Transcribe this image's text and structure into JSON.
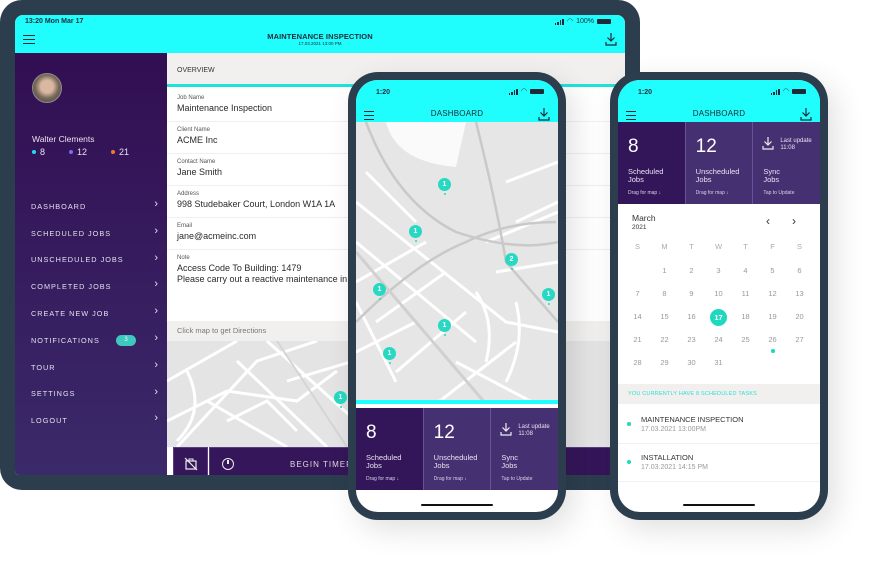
{
  "tablet": {
    "status": {
      "time": "13:20  Mon Mar 17",
      "battery": "100%"
    },
    "header": {
      "title": "MAINTENANCE INSPECTION",
      "subtitle": "17.03.2021   13:00 PM"
    },
    "user": {
      "name": "Walter Clements",
      "stats": [
        {
          "value": "8",
          "color": "#1fe0f0"
        },
        {
          "value": "12",
          "color": "#7b6cf0"
        },
        {
          "value": "21",
          "color": "#f07a2a"
        }
      ]
    },
    "nav": [
      {
        "label": "DASHBOARD"
      },
      {
        "label": "SCHEDULED JOBS"
      },
      {
        "label": "UNSCHEDULED JOBS"
      },
      {
        "label": "COMPLETED JOBS"
      },
      {
        "label": "CREATE NEW JOB"
      },
      {
        "label": "NOTIFICATIONS",
        "badge": "3"
      },
      {
        "label": "TOUR"
      },
      {
        "label": "SETTINGS"
      },
      {
        "label": "LOGOUT"
      }
    ],
    "overview_label": "OVERVIEW",
    "fields": [
      {
        "label": "Job Name",
        "value": "Maintenance Inspection"
      },
      {
        "label": "Client Name",
        "value": "ACME Inc"
      },
      {
        "label": "Contact Name",
        "value": "Jane Smith"
      },
      {
        "label": "Address",
        "value": "998 Studebaker Court, London W1A 1A"
      },
      {
        "label": "Email",
        "value": "jane@acmeinc.com"
      },
      {
        "label": "Note",
        "value": "Access Code To Building: 1479",
        "value2": "Please carry out a reactive maintenance in"
      }
    ],
    "directions_label": "Click map to get Directions",
    "map_pin": "1",
    "begin_timer_label": "BEGIN TIMER"
  },
  "phone1": {
    "time": "1:20",
    "title": "DASHBOARD",
    "pins": [
      "1",
      "1",
      "2",
      "1",
      "1",
      "1",
      "1"
    ],
    "tiles": [
      {
        "num": "8",
        "label1": "Scheduled",
        "label2": "Jobs",
        "sub": "Drag for map ↓"
      },
      {
        "num": "12",
        "label1": "Unscheduled",
        "label2": "Jobs",
        "sub": "Drag for map ↓"
      },
      {
        "update1": "Last update",
        "update2": "11:08",
        "label1": "Sync",
        "label2": "Jobs",
        "sub": "Tap to Update"
      }
    ]
  },
  "phone2": {
    "time": "1:20",
    "title": "DASHBOARD",
    "tiles": [
      {
        "num": "8",
        "label1": "Scheduled",
        "label2": "Jobs",
        "sub": "Drag for map ↓"
      },
      {
        "num": "12",
        "label1": "Unscheduled",
        "label2": "Jobs",
        "sub": "Drag for map ↓"
      },
      {
        "update1": "Last update",
        "update2": "11:08",
        "label1": "Sync",
        "label2": "Jobs",
        "sub": "Tap to Update"
      }
    ],
    "calendar": {
      "month": "March",
      "year": "2021",
      "weekdays": [
        "S",
        "M",
        "T",
        "W",
        "T",
        "F",
        "S"
      ],
      "leading_blanks": 1,
      "days": 31,
      "selected": 17,
      "event_days": [
        26
      ]
    },
    "tasks_heading": "YOU CURRENTLY HAVE 8 SCHEDULED TASKS",
    "tasks": [
      {
        "title": "MAINTENANCE INSPECTION",
        "time": "17.03.2021   13:00PM"
      },
      {
        "title": "INSTALLATION",
        "time": "17.03.2021   14:15 PM"
      }
    ]
  },
  "colors": {
    "accent_cyan": "#1ffdfd",
    "teal": "#1ed8c0",
    "purple_dark": "#33155a",
    "purple": "#453072",
    "frame": "#2c3e4e"
  }
}
